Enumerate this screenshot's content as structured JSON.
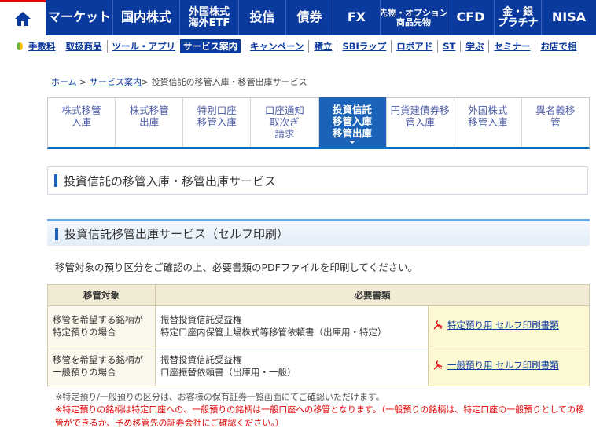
{
  "topnav": {
    "items": [
      {
        "label": "マーケット",
        "size": "big",
        "w": 85
      },
      {
        "label": "国内株式",
        "size": "big",
        "w": 85
      },
      {
        "label": "外国株式\n海外ETF",
        "size": "mid",
        "w": 75
      },
      {
        "label": "投信",
        "size": "big",
        "w": 60
      },
      {
        "label": "債券",
        "size": "big",
        "w": 60
      },
      {
        "label": "FX",
        "size": "big",
        "w": 60
      },
      {
        "label": "先物・オプション\n商品先物",
        "size": "sm",
        "w": 85
      },
      {
        "label": "CFD",
        "size": "big",
        "w": 60
      },
      {
        "label": "金・銀\nプラチナ",
        "size": "mid",
        "w": 60
      },
      {
        "label": "NISA",
        "size": "big",
        "w": 40
      }
    ]
  },
  "subnav": {
    "items": [
      "手数料",
      "取扱商品",
      "ツール・アプリ",
      "サービス案内",
      "キャンペーン",
      "積立",
      "SBIラップ",
      "ロボアド",
      "ST",
      "学ぶ",
      "セミナー",
      "お店で相"
    ],
    "active_index": 3
  },
  "breadcrumb": {
    "home": "ホーム",
    "service": "サービス案内",
    "current": "> 投資信託の移管入庫・移管出庫サービス",
    "sep": " > "
  },
  "tabs": [
    {
      "label": "株式移管\n入庫",
      "active": false
    },
    {
      "label": "株式移管\n出庫",
      "active": false
    },
    {
      "label": "特別口座\n移管入庫",
      "active": false
    },
    {
      "label": "口座通知\n取次ぎ\n請求",
      "active": false
    },
    {
      "label": "投資信託\n移管入庫\n移管出庫",
      "active": true
    },
    {
      "label": "円貨建債券移\n管入庫",
      "active": false
    },
    {
      "label": "外国株式\n移管入庫",
      "active": false
    },
    {
      "label": "異名義移\n管",
      "active": false
    }
  ],
  "section_title": "投資信託の移管入庫・移管出庫サービス",
  "subsection_title": "投資信託移管出庫サービス（セルフ印刷）",
  "description": "移管対象の預り区分をご確認の上、必要書類のPDFファイルを印刷してください。",
  "table": {
    "header_target": "移管対象",
    "header_docs": "必要書類",
    "rows": [
      {
        "target_line1": "移管を希望する銘柄が",
        "target_line2": "特定預りの場合",
        "doc_line1": "振替投資信託受益権",
        "doc_line2": "特定口座内保管上場株式等移管依頼書（出庫用・特定）",
        "link": "特定預り用 セルフ印刷書類"
      },
      {
        "target_line1": "移管を希望する銘柄が",
        "target_line2": "一般預りの場合",
        "doc_line1": "振替投資信託受益権",
        "doc_line2": "口座振替依頼書（出庫用・一般）",
        "link": "一般預り用 セルフ印刷書類"
      }
    ]
  },
  "note1": "※特定預り/一般預りの区分は、お客様の保有証券一覧画面にてご確認いただけます。",
  "note2": "※特定預りの銘柄は特定口座への、一般預りの銘柄は一般口座への移管となります。（一般預りの銘柄は、特定口座の一般預りとしての移管ができるか、予め移管先の証券会社にご確認ください。）",
  "colors": {
    "nav_bg": "#0b3a9e",
    "accent_red": "#e8000b",
    "tab_active": "#1a63b8",
    "note_red": "#e00000"
  }
}
